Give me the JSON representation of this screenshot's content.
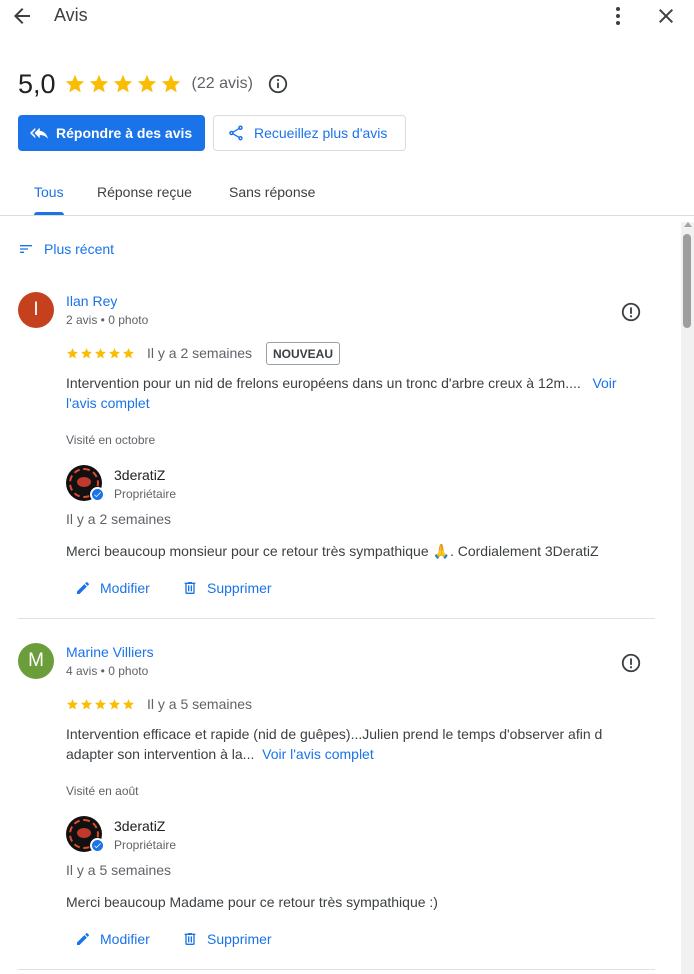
{
  "header": {
    "title": "Avis",
    "back_icon": "arrow-back-icon",
    "more_icon": "more-vert-icon",
    "close_icon": "close-icon"
  },
  "summary": {
    "rating": "5,0",
    "stars": 5,
    "count": "(22 avis)",
    "info_icon": "info-icon"
  },
  "actions": {
    "reply_label": "Répondre à des avis",
    "collect_label": "Recueillez plus d'avis"
  },
  "tabs": [
    {
      "label": "Tous",
      "active": true
    },
    {
      "label": "Réponse reçue",
      "active": false
    },
    {
      "label": "Sans réponse",
      "active": false
    }
  ],
  "sort": {
    "label": "Plus récent"
  },
  "colors": {
    "accent": "#1a73e8",
    "star": "#fbbc04",
    "avatar1": "#c5411d",
    "avatar2": "#6b9d3a"
  },
  "reviews": [
    {
      "initial": "I",
      "author": "Ilan Rey",
      "meta": "2 avis • 0 photo",
      "stars": 5,
      "time": "Il y a 2 semaines",
      "badge": "NOUVEAU",
      "text": "Intervention pour un nid de frelons européens dans un tronc d'arbre creux à 12m....",
      "more": "Voir l'avis complet",
      "visited": "Visité en octobre",
      "owner": {
        "name": "3deratiZ",
        "role": "Propriétaire",
        "time": "Il y a 2 semaines",
        "reply": "Merci beaucoup monsieur pour ce retour très sympathique 🙏. Cordialement 3DeratiZ"
      },
      "edit_label": "Modifier",
      "delete_label": "Supprimer"
    },
    {
      "initial": "M",
      "author": "Marine Villiers",
      "meta": "4 avis • 0 photo",
      "stars": 5,
      "time": "Il y a 5 semaines",
      "badge": "",
      "text": "Intervention efficace et rapide (nid de guêpes)...Julien prend le temps d'observer afin d adapter son intervention à la...",
      "more": "Voir l'avis complet",
      "visited": "Visité en août",
      "owner": {
        "name": "3deratiZ",
        "role": "Propriétaire",
        "time": "Il y a 5 semaines",
        "reply": "Merci beaucoup Madame pour ce retour très sympathique :)"
      },
      "edit_label": "Modifier",
      "delete_label": "Supprimer"
    }
  ]
}
